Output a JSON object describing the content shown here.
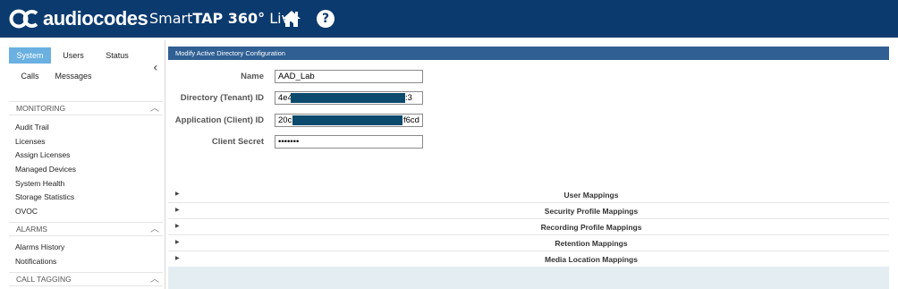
{
  "header": {
    "logo_text": "audiocodes",
    "app_title_prefix": "Smart",
    "app_title_bold": "TAP 360°",
    "app_title_suffix": " Live",
    "home_icon": "home-icon",
    "help_icon": "help-icon",
    "help_glyph": "?"
  },
  "sidebar": {
    "tabs": [
      "System",
      "Users",
      "Status",
      "Calls",
      "Messages"
    ],
    "active_tab": "System",
    "collapse_glyph": "‹",
    "sections": [
      {
        "title": "MONITORING",
        "items": [
          "Audit Trail",
          "Licenses",
          "Assign Licenses",
          "Managed Devices",
          "System Health",
          "Storage Statistics",
          "OVOC"
        ]
      },
      {
        "title": "ALARMS",
        "items": [
          "Alarms History",
          "Notifications"
        ]
      },
      {
        "title": "CALL TAGGING",
        "items": []
      }
    ],
    "chevron_glyph": "︿"
  },
  "panel": {
    "title": "Modify Active Directory Configuration",
    "fields": [
      {
        "label": "Name",
        "value": "AAD_Lab"
      },
      {
        "label": "Directory (Tenant) ID",
        "prefix": "4e4",
        "suffix": ":3"
      },
      {
        "label": "Application (Client) ID",
        "prefix": "20c",
        "suffix": "f6cd"
      },
      {
        "label": "Client Secret",
        "value": "•••••••"
      }
    ],
    "accordion": [
      "User Mappings",
      "Security Profile Mappings",
      "Recording Profile Mappings",
      "Retention Mappings",
      "Media Location Mappings"
    ],
    "accordion_glyph": "▶"
  },
  "colors": {
    "header_bg": "#0b3a6e",
    "active_tab": "#6ab0e0",
    "panel_header": "#2f5f93",
    "redaction": "#0c4a6e"
  }
}
